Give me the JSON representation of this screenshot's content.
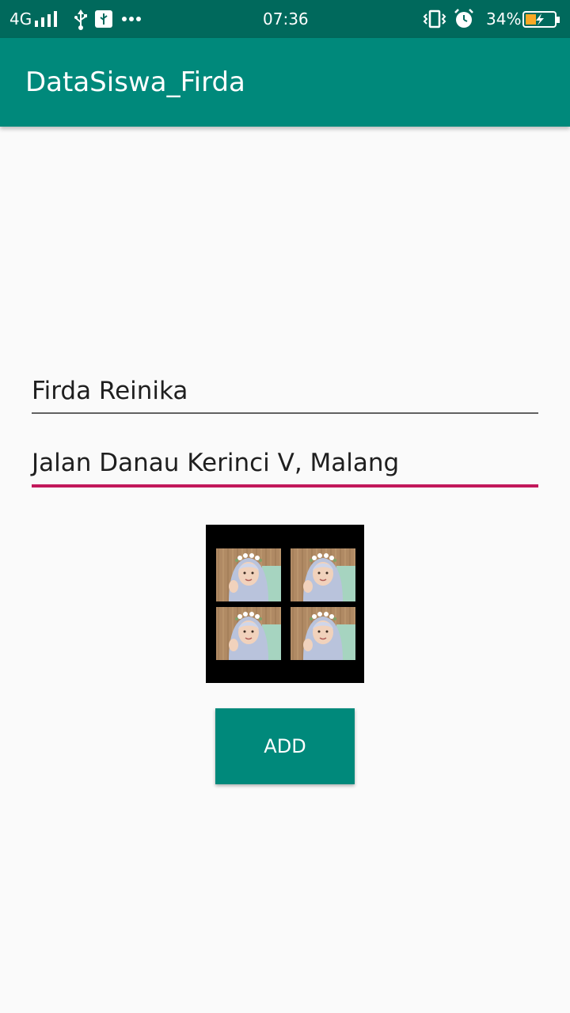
{
  "status_bar": {
    "network": "4G",
    "time": "07:36",
    "battery_percent": "34%",
    "icons": [
      "signal-icon",
      "usb-icon",
      "usb-debug-icon",
      "more-notifications-icon",
      "vibrate-icon",
      "alarm-icon",
      "battery-charging-icon"
    ]
  },
  "app_bar": {
    "title": "DataSiswa_Firda"
  },
  "form": {
    "name_value": "Firda Reinika",
    "address_value": "Jalan Danau Kerinci V, Malang",
    "photo_icon": "student-photo-collage",
    "add_label": "ADD"
  },
  "colors": {
    "status_bar": "#00695c",
    "primary": "#00897b",
    "accent": "#c2185b",
    "background": "#fafafa"
  }
}
